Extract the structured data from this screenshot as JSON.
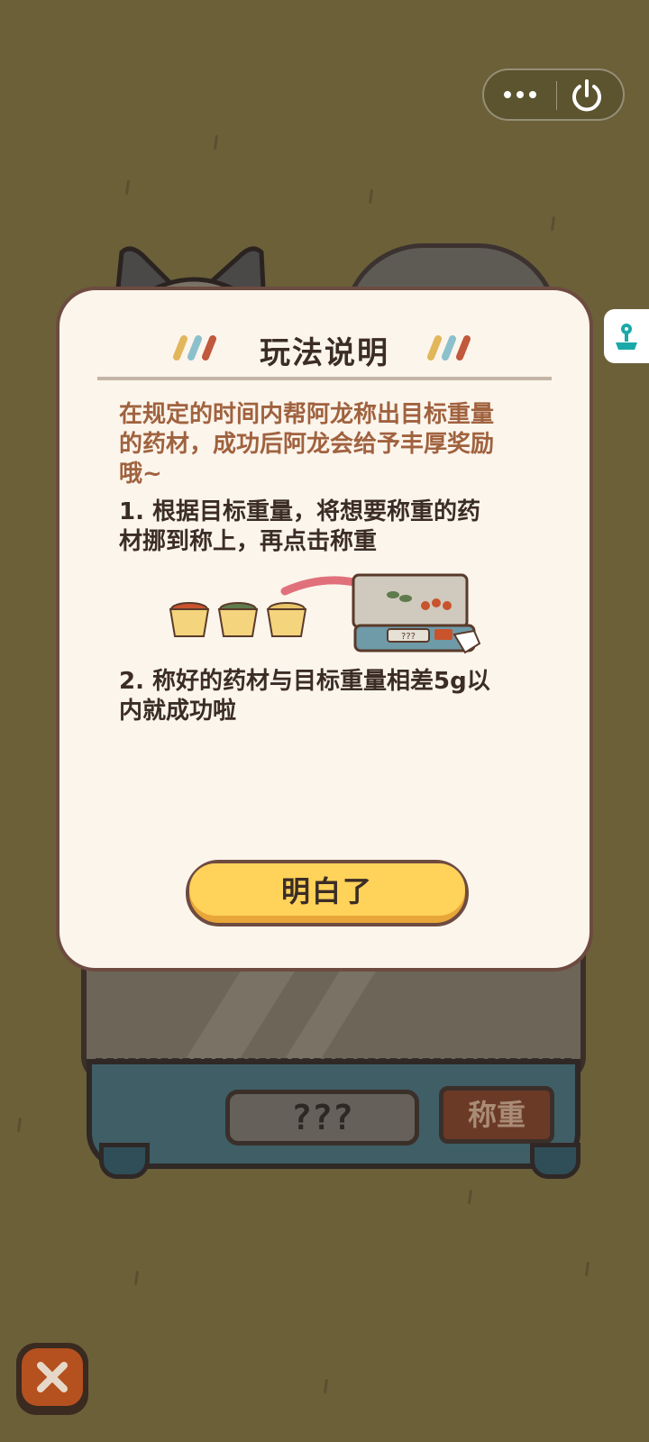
{
  "modal": {
    "title": "玩法说明",
    "intro_lines": [
      "在规定的时间内帮阿龙称出目标重量",
      "的药材，成功后阿龙会给予丰厚奖励",
      "哦~"
    ],
    "step1_lines": [
      "1. 根据目标重量，将想要称重的药",
      "材挪到称上，再点击称重"
    ],
    "step2_lines": [
      "2. 称好的药材与目标重量相差5g以",
      "内就成功啦"
    ],
    "illustration_display": "???",
    "confirm_label": "明白了"
  },
  "background_scale": {
    "display": "???",
    "weigh_label": "称重"
  },
  "colors": {
    "background": "#6b6038",
    "modal_bg": "#fcf5ec",
    "accent_text": "#a0623f",
    "button_yellow": "#ffd25a",
    "close_red": "#b5501f"
  },
  "icons": {
    "menu": "more-dots-icon",
    "exit": "power-icon",
    "side": "joystick-icon",
    "close": "close-icon"
  }
}
